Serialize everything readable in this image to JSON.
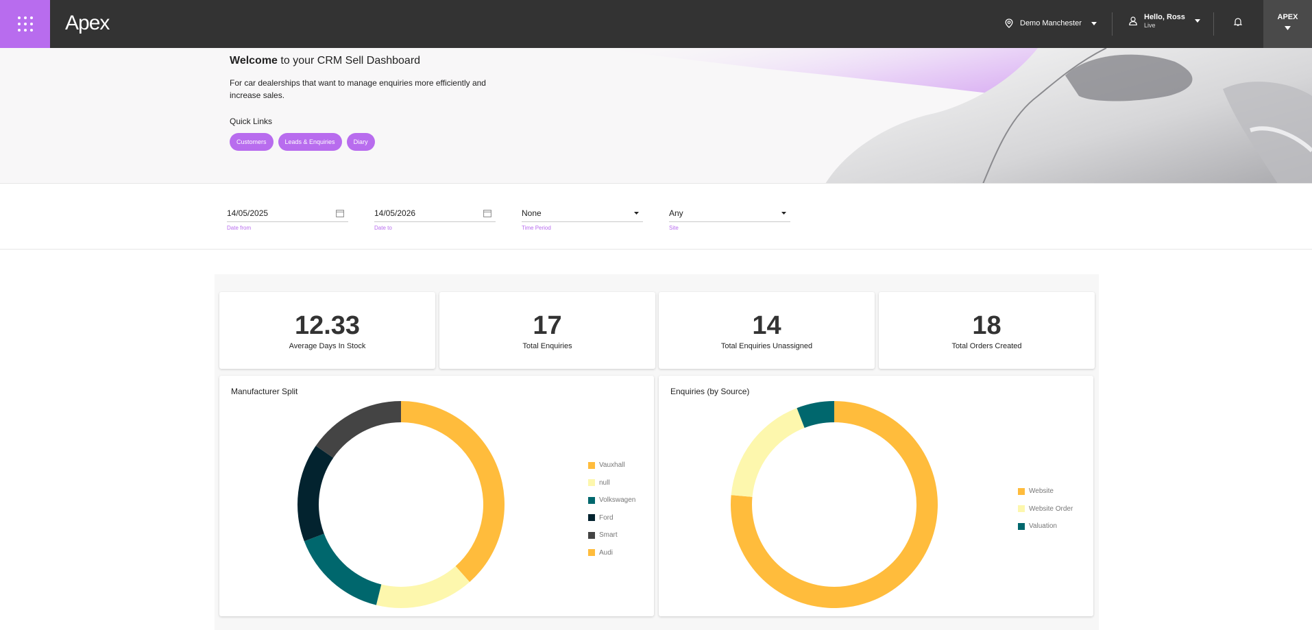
{
  "header": {
    "logo_text": "Apex",
    "location": "Demo Manchester",
    "user_greeting": "Hello, Ross",
    "user_status": "Live",
    "apex_label": "APEX"
  },
  "hero": {
    "welcome_bold": "Welcome",
    "welcome_rest": "to your CRM Sell Dashboard",
    "description": "For car dealerships that want to manage enquiries more efficiently and increase sales.",
    "quick_links_title": "Quick Links",
    "quick_links": [
      "Customers",
      "Leads & Enquiries",
      "Diary"
    ]
  },
  "filters": {
    "date_from": {
      "value": "14/05/2025",
      "label": "Date from"
    },
    "date_to": {
      "value": "14/05/2026",
      "label": "Date to"
    },
    "time_period": {
      "value": "None",
      "label": "Time Period"
    },
    "site": {
      "value": "Any",
      "label": "Site"
    }
  },
  "stats": [
    {
      "value": "12.33",
      "label": "Average Days In Stock"
    },
    {
      "value": "17",
      "label": "Total Enquiries"
    },
    {
      "value": "14",
      "label": "Total Enquiries Unassigned"
    },
    {
      "value": "18",
      "label": "Total Orders Created"
    }
  ],
  "colors": {
    "accent": "#b86cee",
    "topbar": "#333333",
    "yellow": "#ffbc3c",
    "pale_yellow": "#fdf7ad",
    "teal": "#00676d",
    "navy": "#03232f",
    "dark_grey": "#444444"
  },
  "chart_data": [
    {
      "type": "pie",
      "title": "Manufacturer Split",
      "categories": [
        "Vauxhall",
        "null",
        "Volkswagen",
        "Ford",
        "Smart",
        "Audi"
      ],
      "values": [
        5,
        2,
        2,
        2,
        2,
        0
      ],
      "colors": [
        "#ffbc3c",
        "#fdf7ad",
        "#00676d",
        "#03232f",
        "#444444",
        "#ffbc3c"
      ],
      "donut": true,
      "legend": "right"
    },
    {
      "type": "pie",
      "title": "Enquiries (by Source)",
      "categories": [
        "Website",
        "Website Order",
        "Valuation"
      ],
      "values": [
        13,
        3,
        1
      ],
      "colors": [
        "#ffbc3c",
        "#fdf7ad",
        "#00676d"
      ],
      "donut": true,
      "legend": "right"
    }
  ]
}
